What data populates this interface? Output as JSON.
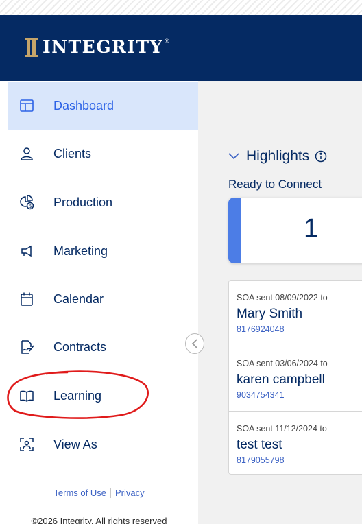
{
  "header": {
    "brand_name": "INTEGRITY",
    "brand_reg": "®",
    "colors": {
      "header_bg": "#052a63",
      "brand_gold": "#c5a46a"
    }
  },
  "sidebar": {
    "items": [
      {
        "label": "Dashboard",
        "icon": "dashboard-icon",
        "active": true
      },
      {
        "label": "Clients",
        "icon": "person-icon"
      },
      {
        "label": "Production",
        "icon": "chart-dollar-icon"
      },
      {
        "label": "Marketing",
        "icon": "megaphone-icon"
      },
      {
        "label": "Calendar",
        "icon": "calendar-icon"
      },
      {
        "label": "Contracts",
        "icon": "contract-sign-icon"
      },
      {
        "label": "Learning",
        "icon": "open-book-icon"
      },
      {
        "label": "View As",
        "icon": "view-as-icon"
      }
    ],
    "footer": {
      "terms": "Terms of Use",
      "privacy": "Privacy",
      "copyright": "©2026 Integrity. All rights reserved"
    },
    "colors": {
      "active_bg": "#d9e6fb",
      "active_text": "#2c62e6",
      "text": "#052a63"
    }
  },
  "main": {
    "highlights_title": "Highlights",
    "ready_to_connect_label": "Ready to Connect",
    "ready_to_connect_count": "1",
    "soa_items": [
      {
        "sent": "SOA sent 08/09/2022 to",
        "name": "Mary Smith",
        "phone": "8176924048"
      },
      {
        "sent": "SOA sent 03/06/2024 to",
        "name": "karen campbell",
        "phone": "9034754341"
      },
      {
        "sent": "SOA sent 11/12/2024 to",
        "name": "test test",
        "phone": "8179055798"
      }
    ]
  }
}
